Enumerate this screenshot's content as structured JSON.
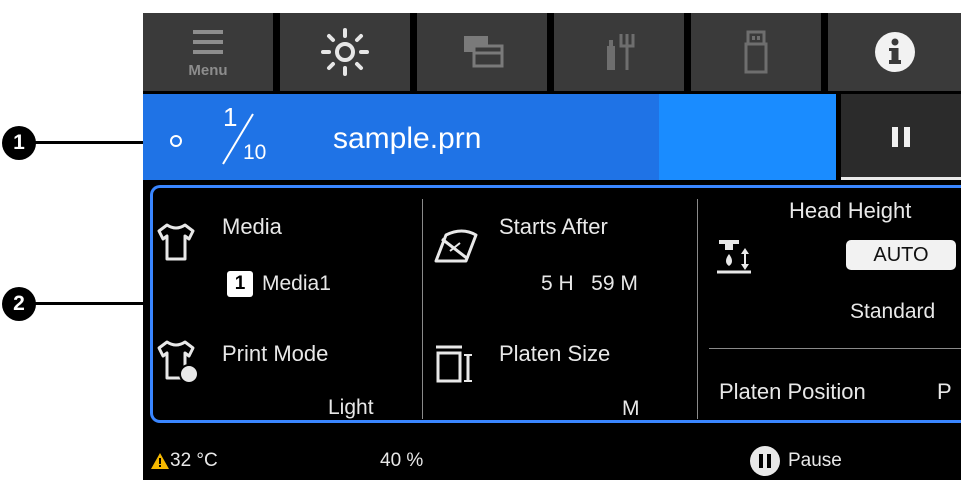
{
  "toolbar": {
    "menu_label": "Menu",
    "icons": [
      "menu-icon",
      "brightness-icon",
      "windows-icon",
      "maintenance-icon",
      "usb-icon",
      "info-icon"
    ]
  },
  "job": {
    "current": "1",
    "total": "10",
    "file_name": "sample.prn"
  },
  "settings": {
    "media_label": "Media",
    "media_number": "1",
    "media_value": "Media1",
    "print_mode_label": "Print Mode",
    "print_mode_value": "Light",
    "starts_after_label": "Starts After",
    "starts_after_value": "5 H   59 M",
    "platen_size_label": "Platen Size",
    "platen_size_value": "M",
    "head_height_label": "Head Height",
    "head_height_mode": "AUTO",
    "head_height_value": "Standard",
    "platen_position_label": "Platen Position",
    "platen_position_value": "P"
  },
  "statusbar": {
    "temperature": "32 °C",
    "humidity": "40 %",
    "pause_label": "Pause"
  },
  "callouts": {
    "one": "1",
    "two": "2"
  },
  "colors": {
    "print_bar": "#1f73e6",
    "progress_fill": "#1a8cff",
    "panel_border": "#3a86ff",
    "warning": "#f5b800"
  }
}
